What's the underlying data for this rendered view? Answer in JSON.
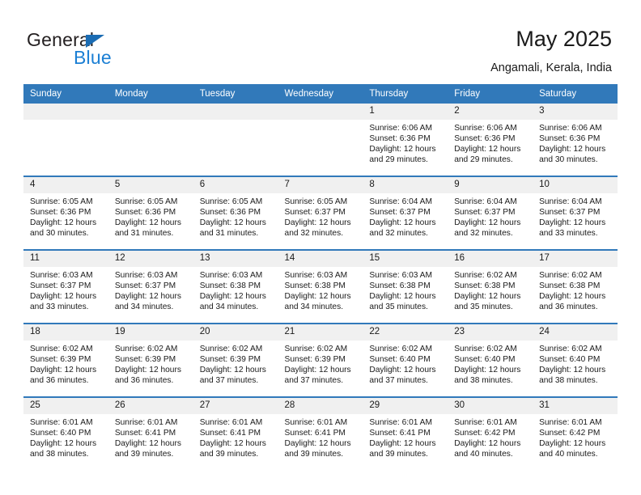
{
  "brand": {
    "name_top": "General",
    "name_bottom": "Blue",
    "triangle_color": "#1b6cb3",
    "blue_color": "#1b7fd4"
  },
  "header": {
    "title": "May 2025",
    "subtitle": "Angamali, Kerala, India",
    "accent_color": "#3179ba",
    "daynum_band_color": "#f0f0f0"
  },
  "weekdays": [
    "Sunday",
    "Monday",
    "Tuesday",
    "Wednesday",
    "Thursday",
    "Friday",
    "Saturday"
  ],
  "labels": {
    "sunrise": "Sunrise:",
    "sunset": "Sunset:",
    "daylight": "Daylight:"
  },
  "weeks": [
    [
      {
        "day": "",
        "blank": true
      },
      {
        "day": "",
        "blank": true
      },
      {
        "day": "",
        "blank": true
      },
      {
        "day": "",
        "blank": true
      },
      {
        "day": "1",
        "sunrise": "Sunrise: 6:06 AM",
        "sunset": "Sunset: 6:36 PM",
        "daylight": "Daylight: 12 hours and 29 minutes."
      },
      {
        "day": "2",
        "sunrise": "Sunrise: 6:06 AM",
        "sunset": "Sunset: 6:36 PM",
        "daylight": "Daylight: 12 hours and 29 minutes."
      },
      {
        "day": "3",
        "sunrise": "Sunrise: 6:06 AM",
        "sunset": "Sunset: 6:36 PM",
        "daylight": "Daylight: 12 hours and 30 minutes."
      }
    ],
    [
      {
        "day": "4",
        "sunrise": "Sunrise: 6:05 AM",
        "sunset": "Sunset: 6:36 PM",
        "daylight": "Daylight: 12 hours and 30 minutes."
      },
      {
        "day": "5",
        "sunrise": "Sunrise: 6:05 AM",
        "sunset": "Sunset: 6:36 PM",
        "daylight": "Daylight: 12 hours and 31 minutes."
      },
      {
        "day": "6",
        "sunrise": "Sunrise: 6:05 AM",
        "sunset": "Sunset: 6:36 PM",
        "daylight": "Daylight: 12 hours and 31 minutes."
      },
      {
        "day": "7",
        "sunrise": "Sunrise: 6:05 AM",
        "sunset": "Sunset: 6:37 PM",
        "daylight": "Daylight: 12 hours and 32 minutes."
      },
      {
        "day": "8",
        "sunrise": "Sunrise: 6:04 AM",
        "sunset": "Sunset: 6:37 PM",
        "daylight": "Daylight: 12 hours and 32 minutes."
      },
      {
        "day": "9",
        "sunrise": "Sunrise: 6:04 AM",
        "sunset": "Sunset: 6:37 PM",
        "daylight": "Daylight: 12 hours and 32 minutes."
      },
      {
        "day": "10",
        "sunrise": "Sunrise: 6:04 AM",
        "sunset": "Sunset: 6:37 PM",
        "daylight": "Daylight: 12 hours and 33 minutes."
      }
    ],
    [
      {
        "day": "11",
        "sunrise": "Sunrise: 6:03 AM",
        "sunset": "Sunset: 6:37 PM",
        "daylight": "Daylight: 12 hours and 33 minutes."
      },
      {
        "day": "12",
        "sunrise": "Sunrise: 6:03 AM",
        "sunset": "Sunset: 6:37 PM",
        "daylight": "Daylight: 12 hours and 34 minutes."
      },
      {
        "day": "13",
        "sunrise": "Sunrise: 6:03 AM",
        "sunset": "Sunset: 6:38 PM",
        "daylight": "Daylight: 12 hours and 34 minutes."
      },
      {
        "day": "14",
        "sunrise": "Sunrise: 6:03 AM",
        "sunset": "Sunset: 6:38 PM",
        "daylight": "Daylight: 12 hours and 34 minutes."
      },
      {
        "day": "15",
        "sunrise": "Sunrise: 6:03 AM",
        "sunset": "Sunset: 6:38 PM",
        "daylight": "Daylight: 12 hours and 35 minutes."
      },
      {
        "day": "16",
        "sunrise": "Sunrise: 6:02 AM",
        "sunset": "Sunset: 6:38 PM",
        "daylight": "Daylight: 12 hours and 35 minutes."
      },
      {
        "day": "17",
        "sunrise": "Sunrise: 6:02 AM",
        "sunset": "Sunset: 6:38 PM",
        "daylight": "Daylight: 12 hours and 36 minutes."
      }
    ],
    [
      {
        "day": "18",
        "sunrise": "Sunrise: 6:02 AM",
        "sunset": "Sunset: 6:39 PM",
        "daylight": "Daylight: 12 hours and 36 minutes."
      },
      {
        "day": "19",
        "sunrise": "Sunrise: 6:02 AM",
        "sunset": "Sunset: 6:39 PM",
        "daylight": "Daylight: 12 hours and 36 minutes."
      },
      {
        "day": "20",
        "sunrise": "Sunrise: 6:02 AM",
        "sunset": "Sunset: 6:39 PM",
        "daylight": "Daylight: 12 hours and 37 minutes."
      },
      {
        "day": "21",
        "sunrise": "Sunrise: 6:02 AM",
        "sunset": "Sunset: 6:39 PM",
        "daylight": "Daylight: 12 hours and 37 minutes."
      },
      {
        "day": "22",
        "sunrise": "Sunrise: 6:02 AM",
        "sunset": "Sunset: 6:40 PM",
        "daylight": "Daylight: 12 hours and 37 minutes."
      },
      {
        "day": "23",
        "sunrise": "Sunrise: 6:02 AM",
        "sunset": "Sunset: 6:40 PM",
        "daylight": "Daylight: 12 hours and 38 minutes."
      },
      {
        "day": "24",
        "sunrise": "Sunrise: 6:02 AM",
        "sunset": "Sunset: 6:40 PM",
        "daylight": "Daylight: 12 hours and 38 minutes."
      }
    ],
    [
      {
        "day": "25",
        "sunrise": "Sunrise: 6:01 AM",
        "sunset": "Sunset: 6:40 PM",
        "daylight": "Daylight: 12 hours and 38 minutes."
      },
      {
        "day": "26",
        "sunrise": "Sunrise: 6:01 AM",
        "sunset": "Sunset: 6:41 PM",
        "daylight": "Daylight: 12 hours and 39 minutes."
      },
      {
        "day": "27",
        "sunrise": "Sunrise: 6:01 AM",
        "sunset": "Sunset: 6:41 PM",
        "daylight": "Daylight: 12 hours and 39 minutes."
      },
      {
        "day": "28",
        "sunrise": "Sunrise: 6:01 AM",
        "sunset": "Sunset: 6:41 PM",
        "daylight": "Daylight: 12 hours and 39 minutes."
      },
      {
        "day": "29",
        "sunrise": "Sunrise: 6:01 AM",
        "sunset": "Sunset: 6:41 PM",
        "daylight": "Daylight: 12 hours and 39 minutes."
      },
      {
        "day": "30",
        "sunrise": "Sunrise: 6:01 AM",
        "sunset": "Sunset: 6:42 PM",
        "daylight": "Daylight: 12 hours and 40 minutes."
      },
      {
        "day": "31",
        "sunrise": "Sunrise: 6:01 AM",
        "sunset": "Sunset: 6:42 PM",
        "daylight": "Daylight: 12 hours and 40 minutes."
      }
    ]
  ]
}
